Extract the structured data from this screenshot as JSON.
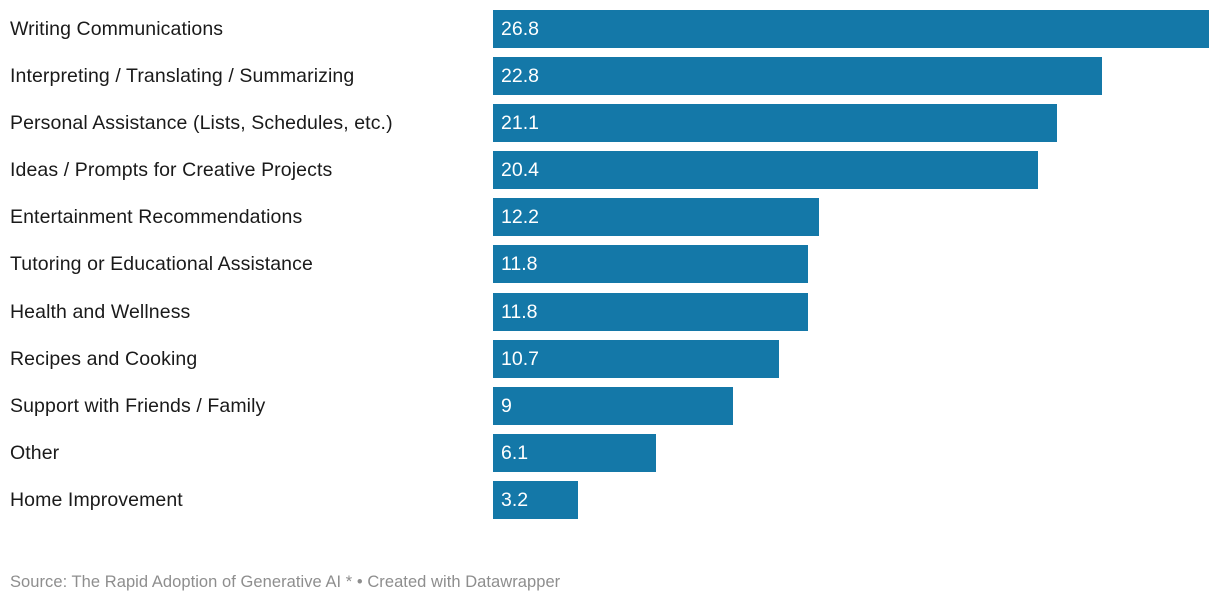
{
  "footer": {
    "text": "Source: The Rapid Adoption of Generative AI * • Created with Datawrapper"
  },
  "colors": {
    "bar": "#1478a8",
    "label_text": "#1a1a1a",
    "value_text": "#ffffff",
    "footer_text": "#8e8e8e",
    "background": "#ffffff"
  },
  "chart_data": {
    "type": "bar",
    "orientation": "horizontal",
    "title": "",
    "subtitle": "",
    "xlabel": "",
    "ylabel": "",
    "grid": false,
    "legend": "none",
    "axis_visible": false,
    "value_labels": "inside-left",
    "xlim": [
      0,
      26.8
    ],
    "categories": [
      "Writing Communications",
      "Interpreting / Translating / Summarizing",
      "Personal Assistance (Lists, Schedules, etc.)",
      "Ideas / Prompts for Creative Projects",
      "Entertainment Recommendations",
      "Tutoring or Educational Assistance",
      "Health and Wellness",
      "Recipes and Cooking",
      "Support with Friends / Family",
      "Other",
      "Home Improvement"
    ],
    "values": [
      26.8,
      22.8,
      21.1,
      20.4,
      12.2,
      11.8,
      11.8,
      10.7,
      9,
      6.1,
      3.2
    ],
    "value_labels_text": [
      "26.8",
      "22.8",
      "21.1",
      "20.4",
      "12.2",
      "11.8",
      "11.8",
      "10.7",
      "9",
      "6.1",
      "3.2"
    ],
    "source": "The Rapid Adoption of Generative AI",
    "created_with": "Datawrapper"
  }
}
